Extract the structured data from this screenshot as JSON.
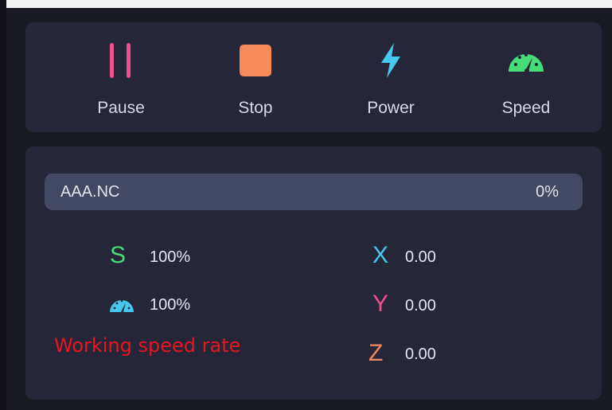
{
  "controls": {
    "pause_label": "Pause",
    "stop_label": "Stop",
    "power_label": "Power",
    "speed_label": "Speed"
  },
  "job": {
    "file_name": "AAA.NC",
    "progress_text": "0%",
    "progress_fraction": 0
  },
  "rates": {
    "spindle_letter": "S",
    "spindle_value": "100%",
    "feed_value": "100%"
  },
  "axes": {
    "x_letter": "X",
    "x_value": "0.00",
    "y_letter": "Y",
    "y_value": "0.00",
    "z_letter": "Z",
    "z_value": "0.00"
  },
  "annotation": "Working speed rate",
  "colors": {
    "pause": "#f0508c",
    "stop": "#f58a5c",
    "power": "#46c8f0",
    "speed": "#46dc78",
    "spindle": "#46dc78",
    "feed": "#46c8f0",
    "x": "#46c8f0",
    "y": "#f0508c",
    "z": "#f58a5c",
    "annotation": "#e8141e"
  },
  "icons": {
    "pause": "pause-icon",
    "stop": "stop-icon",
    "power": "lightning-icon",
    "speed": "speedometer-icon",
    "feed": "speedometer-icon"
  }
}
